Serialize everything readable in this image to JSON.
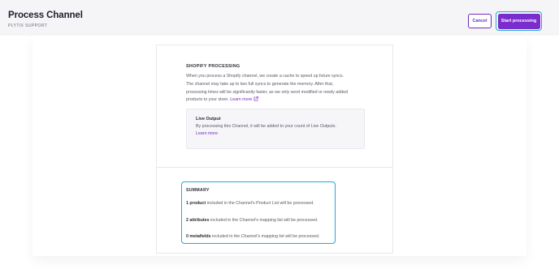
{
  "header": {
    "title": "Process Channel",
    "subtitle": "PLYTIX SUPPORT",
    "cancel_label": "Cancel",
    "start_label": "Start processing"
  },
  "shopify": {
    "title": "SHOPIFY PROCESSING",
    "description_lines": [
      "When you process a Shopify channel, we create a cache to speed up future syncs.",
      "The channel may take up to two full syncs to generate the memory. After that,",
      "processing times will be significantly faster, as we only send modified or newly added",
      "products to your store."
    ],
    "learn_more": "Learn more"
  },
  "live_output": {
    "title": "Live Output",
    "description": "By processing this Channel, it will be added to your count of Live Outputs.",
    "learn_more": "Learn more"
  },
  "summary": {
    "title": "SUMMARY",
    "products_count": "1 product",
    "products_text": " included in the Channel's Product List will be processed.",
    "attributes_count": "2 attributes",
    "attributes_text": " included in the Channel's mapping list will be processed.",
    "metafields_count": "0 metafields",
    "metafields_text": " included in the Channel's mapping list will be processed."
  },
  "colors": {
    "brand": "#7a2ccc",
    "highlight": "#2aa7d6",
    "link": "#6f2bb8"
  },
  "icons": {
    "learn_more": "external-link-icon"
  }
}
